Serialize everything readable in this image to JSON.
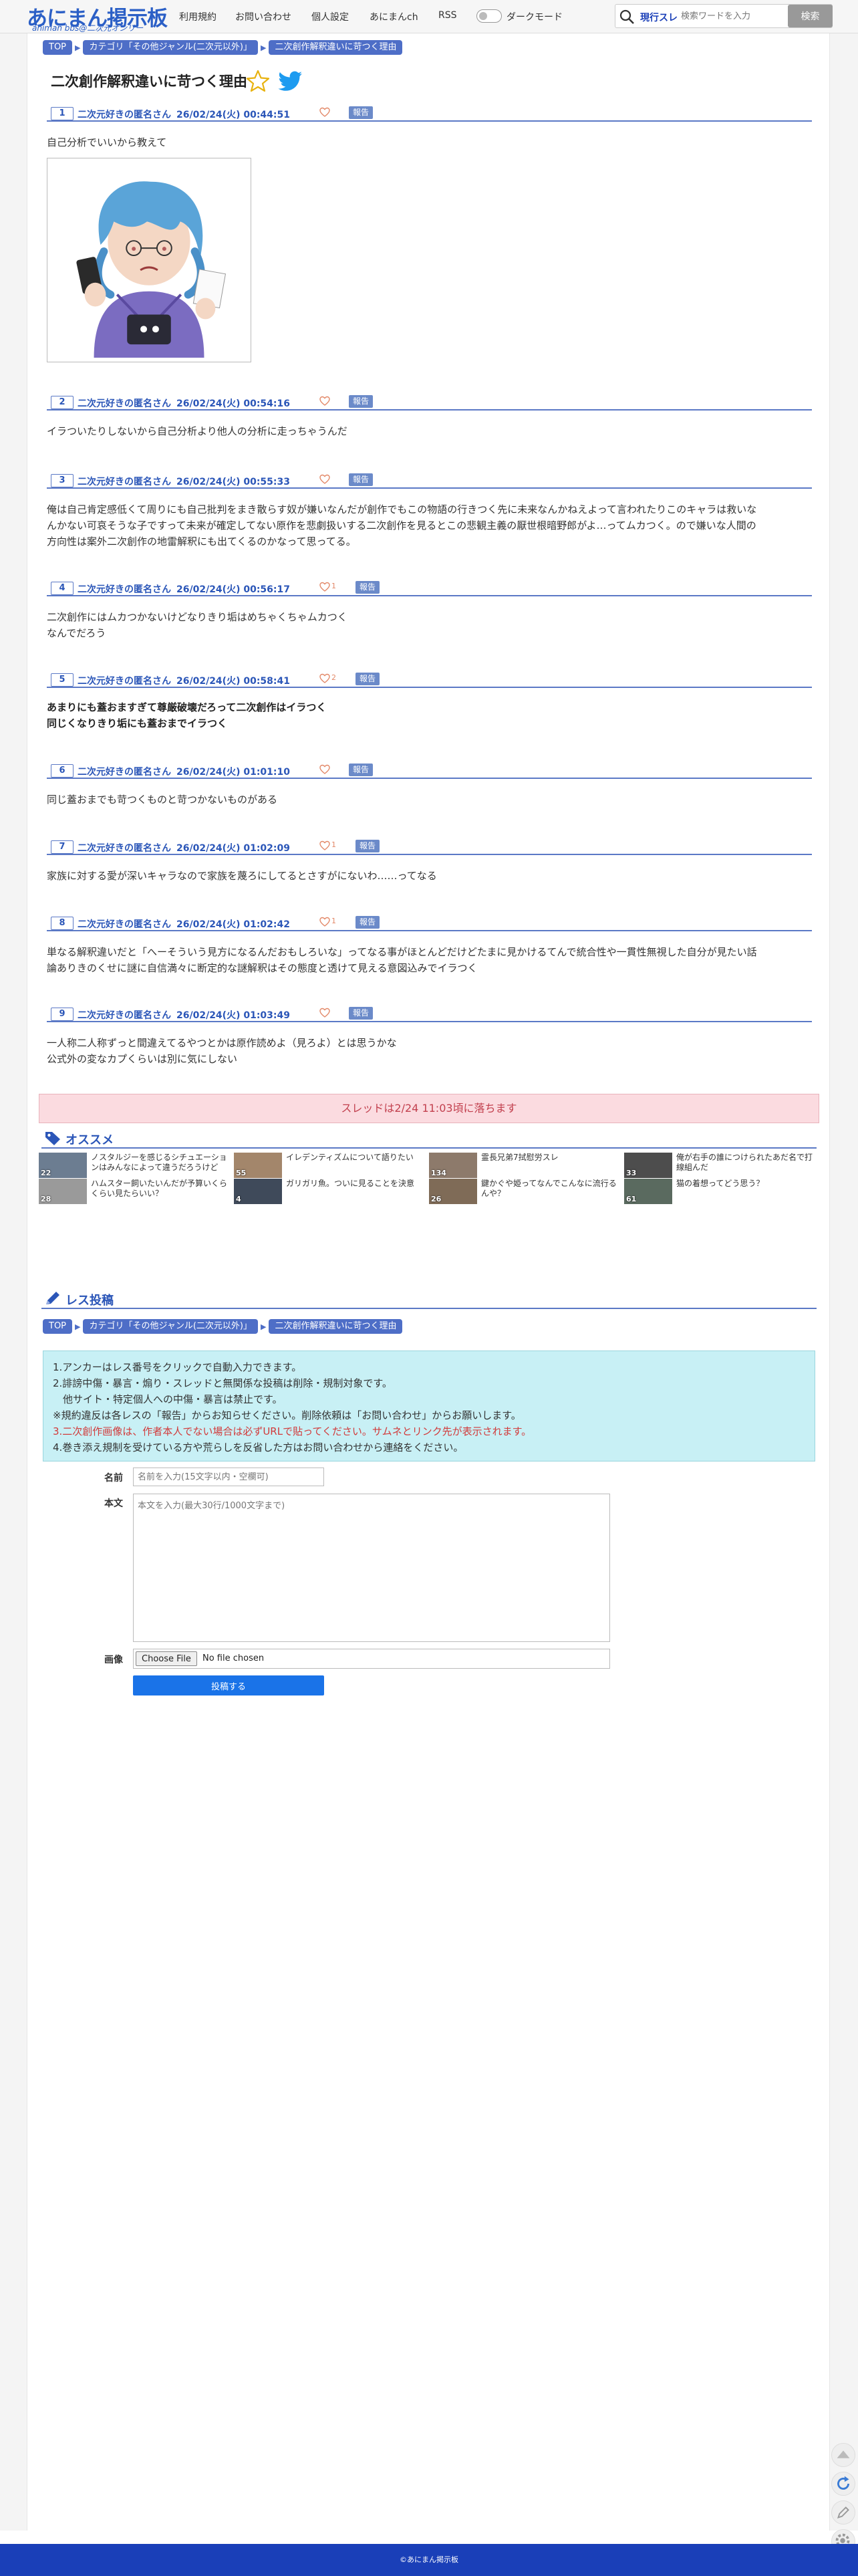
{
  "header": {
    "logo_main": "あにまん掲示板",
    "logo_sub": "animan bbs@二次元オンリー",
    "nav": [
      "利用規約",
      "お問い合わせ",
      "個人設定",
      "あにまんch",
      "RSS"
    ],
    "dark_mode_label": "ダークモード",
    "search_scope": "現行スレ",
    "search_placeholder": "検索ワードを入力",
    "search_button": "検索"
  },
  "breadcrumb": [
    "TOP",
    "カテゴリ「その他ジャンル(二次元以外)」",
    "二次創作解釈違いに苛つく理由"
  ],
  "thread_title": "二次創作解釈違いに苛つく理由",
  "report_label": "報告",
  "posts": [
    {
      "no": "1",
      "name": "二次元好きの匿名さん",
      "date": "26/02/24(火) 00:44:51",
      "likes": "",
      "lines": [
        "自己分析でいいから教えて"
      ]
    },
    {
      "no": "2",
      "name": "二次元好きの匿名さん",
      "date": "26/02/24(火) 00:54:16",
      "likes": "",
      "lines": [
        "イラついたりしないから自己分析より他人の分析に走っちゃうんだ"
      ]
    },
    {
      "no": "3",
      "name": "二次元好きの匿名さん",
      "date": "26/02/24(火) 00:55:33",
      "likes": "",
      "lines": [
        "俺は自己肯定感低くて周りにも自己批判をまき散らす奴が嫌いなんだが創作でもこの物語の行きつく先に未来なんかねえよって言われたりこのキャラは救いな",
        "んかない可哀そうな子ですって未来が確定してない原作を悲劇扱いする二次創作を見るとこの悲観主義の厭世根暗野郎がよ…ってムカつく。ので嫌いな人間の",
        "方向性は案外二次創作の地雷解釈にも出てくるのかなって思ってる。"
      ]
    },
    {
      "no": "4",
      "name": "二次元好きの匿名さん",
      "date": "26/02/24(火) 00:56:17",
      "likes": "1",
      "lines": [
        "二次創作にはムカつかないけどなりきり垢はめちゃくちゃムカつく",
        "なんでだろう"
      ]
    },
    {
      "no": "5",
      "name": "二次元好きの匿名さん",
      "date": "26/02/24(火) 00:58:41",
      "likes": "2",
      "lines": [
        "あまりにも蓋おますぎて尊厳破壊だろって二次創作はイラつく",
        "同じくなりきり垢にも蓋おまでイラつく"
      ]
    },
    {
      "no": "6",
      "name": "二次元好きの匿名さん",
      "date": "26/02/24(火) 01:01:10",
      "likes": "",
      "lines": [
        "同じ蓋おまでも苛つくものと苛つかないものがある"
      ]
    },
    {
      "no": "7",
      "name": "二次元好きの匿名さん",
      "date": "26/02/24(火) 01:02:09",
      "likes": "1",
      "lines": [
        "家族に対する愛が深いキャラなので家族を蔑ろにしてるとさすがにないわ……ってなる"
      ]
    },
    {
      "no": "8",
      "name": "二次元好きの匿名さん",
      "date": "26/02/24(火) 01:02:42",
      "likes": "1",
      "lines": [
        "単なる解釈違いだと「へーそういう見方になるんだおもしろいな」ってなる事がほとんどだけどたまに見かけるてんで統合性や一貫性無視した自分が見たい話",
        "論ありきのくせに謎に自信満々に断定的な謎解釈はその態度と透けて見える意図込みでイラつく"
      ]
    },
    {
      "no": "9",
      "name": "二次元好きの匿名さん",
      "date": "26/02/24(火) 01:03:49",
      "likes": "",
      "lines": [
        "一人称二人称ずっと間違えてるやつとかは原作読めよ（見ろよ）とは思うかな",
        "公式外の変なカプくらいは別に気にしない"
      ]
    }
  ],
  "expire_notice": "スレッドは2/24 11:03頃に落ちます",
  "recommend": {
    "title": "オススメ",
    "items": [
      {
        "count": "22",
        "title": "ノスタルジーを感じるシチュエーションはみんなによって違うだろうけど"
      },
      {
        "count": "55",
        "title": "イレデンティズムについて語りたい"
      },
      {
        "count": "134",
        "title": "霊長兄弟7拭慰労スレ"
      },
      {
        "count": "33",
        "title": "俺が右手の誰につけられたあだ名で打線組んだ"
      },
      {
        "count": "28",
        "title": "ハムスター飼いたいんだが予算いくらくらい見たらいい？"
      },
      {
        "count": "4",
        "title": "ガリガリ魚。ついに見ることを決意"
      },
      {
        "count": "26",
        "title": "鍵かぐや姫ってなんでこんなに流行るんや？"
      },
      {
        "count": "61",
        "title": "猫の着想ってどう思う？"
      }
    ]
  },
  "form": {
    "title": "レス投稿",
    "rules": [
      {
        "text": "1.アンカーはレス番号をクリックで自動入力できます。",
        "red": false
      },
      {
        "text": "2.誹謗中傷・暴言・煽り・スレッドと無関係な投稿は削除・規制対象です。",
        "red": false
      },
      {
        "text": "　他サイト・特定個人への中傷・暴言は禁止です。",
        "red": false
      },
      {
        "text": "※規約違反は各レスの「報告」からお知らせください。削除依頼は「お問い合わせ」からお願いします。",
        "red": false
      },
      {
        "text": "3.二次創作画像は、作者本人でない場合は必ずURLで貼ってください。サムネとリンク先が表示されます。",
        "red": true
      },
      {
        "text": "4.巻き添え規制を受けている方や荒らしを反省した方はお問い合わせから連絡をください。",
        "red": false
      }
    ],
    "name_label": "名前",
    "name_placeholder": "名前を入力(15文字以内・空欄可)",
    "body_label": "本文",
    "body_placeholder": "本文を入力(最大30行/1000文字まで)",
    "image_label": "画像",
    "choose_file": "Choose File",
    "no_file": "No file chosen",
    "submit": "投稿する"
  },
  "footer": "©あにまん掲示板",
  "colors": {
    "accent": "#2b56b8",
    "crumb": "#4e6ec7",
    "footer": "#1a3fb8",
    "notice_bg": "#fbdbe0",
    "rules_bg": "#c8f0f5"
  }
}
